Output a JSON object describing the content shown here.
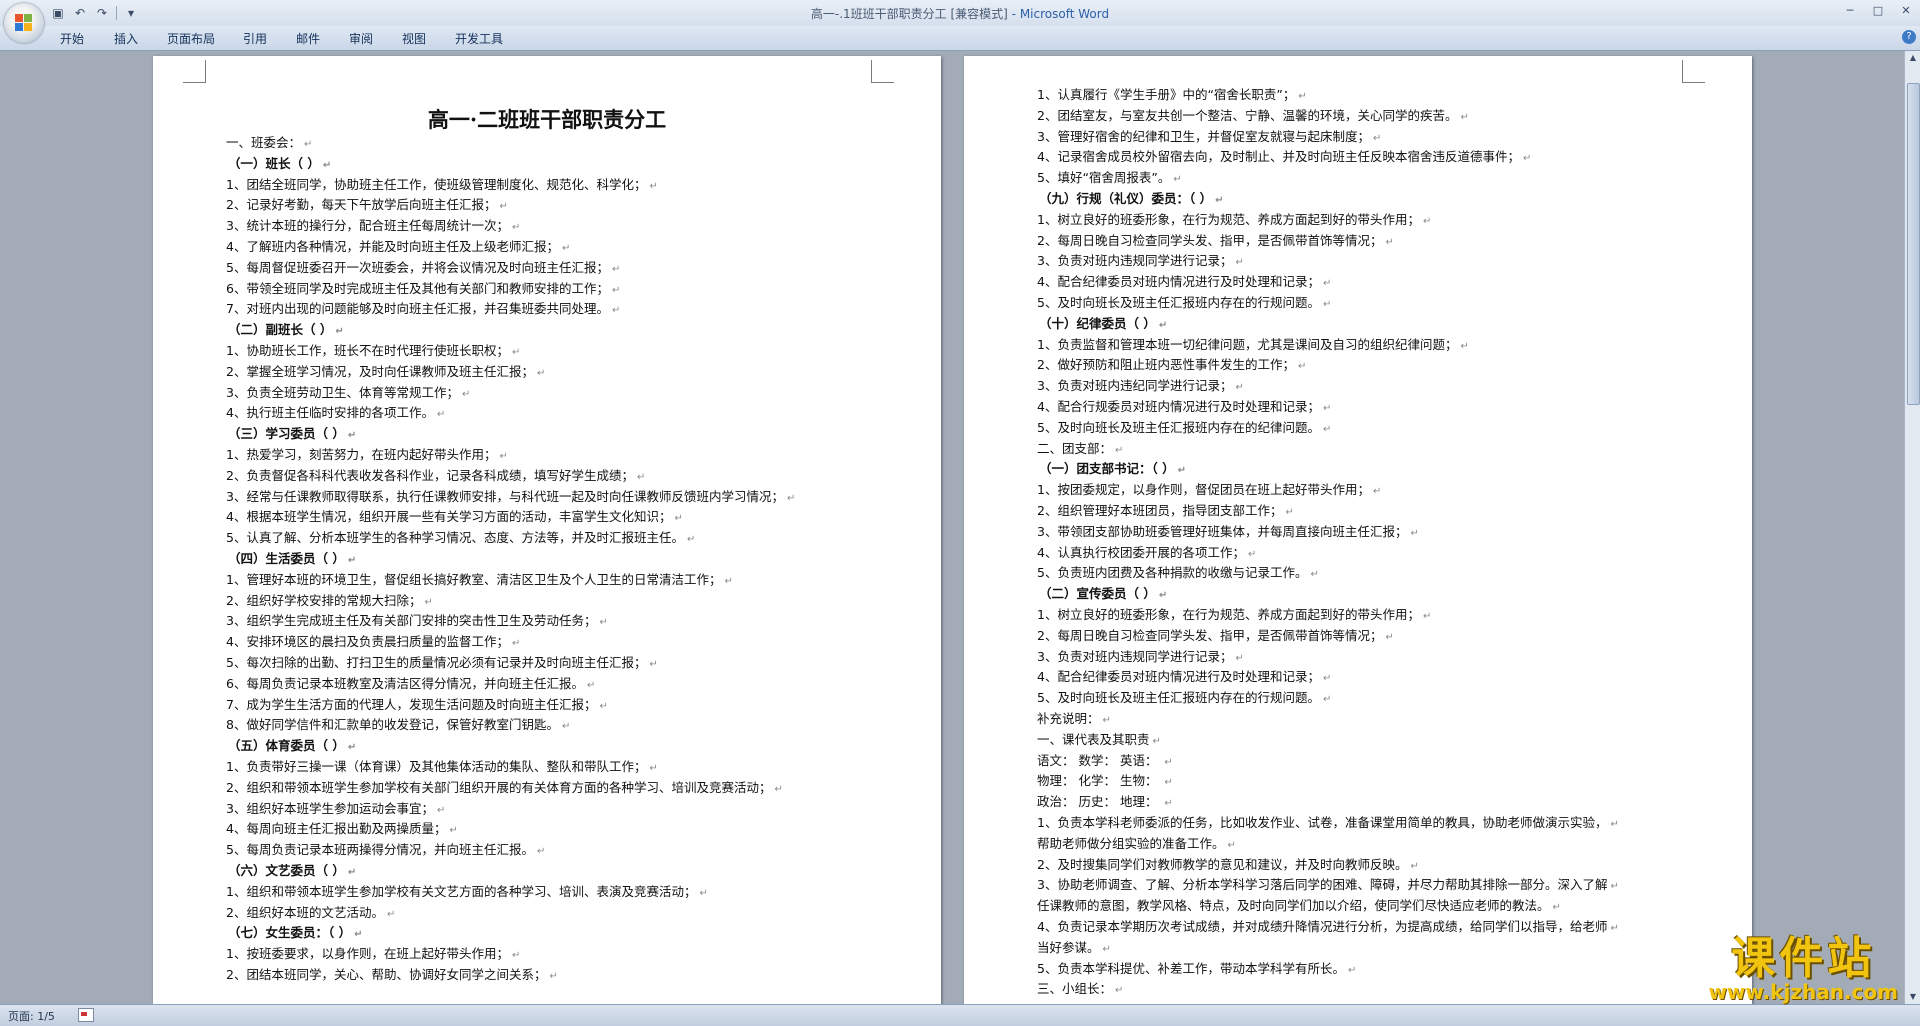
{
  "window": {
    "title": "高一-.1班班干部职责分工 [兼容模式]",
    "app_name": " - Microsoft Word",
    "status": "页面: 1/5"
  },
  "ribbon": {
    "tabs": [
      "开始",
      "插入",
      "页面布局",
      "引用",
      "邮件",
      "审阅",
      "视图",
      "开发工具"
    ]
  },
  "document": {
    "title": "高一·二班班干部职责分工",
    "left_lines": [
      {
        "t": "一、班委会：",
        "h": false
      },
      {
        "t": "（一）班长（          ）",
        "h": true
      },
      {
        "t": "1、团结全班同学，协助班主任工作，使班级管理制度化、规范化、科学化；",
        "h": false
      },
      {
        "t": "2、记录好考勤，每天下午放学后向班主任汇报；",
        "h": false
      },
      {
        "t": "3、统计本班的操行分，配合班主任每周统计一次；",
        "h": false
      },
      {
        "t": "4、了解班内各种情况，并能及时向班主任及上级老师汇报；",
        "h": false
      },
      {
        "t": "5、每周督促班委召开一次班委会，并将会议情况及时向班主任汇报；",
        "h": false
      },
      {
        "t": "6、带领全班同学及时完成班主任及其他有关部门和教师安排的工作；",
        "h": false
      },
      {
        "t": "7、对班内出现的问题能够及时向班主任汇报，并召集班委共同处理。",
        "h": false
      },
      {
        "t": "（二）副班长（          ）",
        "h": true
      },
      {
        "t": "1、协助班长工作，班长不在时代理行使班长职权；",
        "h": false
      },
      {
        "t": "2、掌握全班学习情况，及时向任课教师及班主任汇报；",
        "h": false
      },
      {
        "t": "3、负责全班劳动卫生、体育等常规工作；",
        "h": false
      },
      {
        "t": "4、执行班主任临时安排的各项工作。",
        "h": false
      },
      {
        "t": "（三）学习委员（          ）",
        "h": true
      },
      {
        "t": "1、热爱学习，刻苦努力，在班内起好带头作用；",
        "h": false
      },
      {
        "t": "2、负责督促各科科代表收发各科作业，记录各科成绩，填写好学生成绩；",
        "h": false
      },
      {
        "t": "3、经常与任课教师取得联系，执行任课教师安排，与科代班一起及时向任课教师反馈班内学习情况；",
        "h": false
      },
      {
        "t": "4、根据本班学生情况，组织开展一些有关学习方面的活动，丰富学生文化知识；",
        "h": false
      },
      {
        "t": "5、认真了解、分析本班学生的各种学习情况、态度、方法等，并及时汇报班主任。",
        "h": false
      },
      {
        "t": "（四）生活委员（          ）",
        "h": true
      },
      {
        "t": "1、管理好本班的环境卫生，督促组长搞好教室、清洁区卫生及个人卫生的日常清洁工作；",
        "h": false
      },
      {
        "t": "2、组织好学校安排的常规大扫除；",
        "h": false
      },
      {
        "t": "3、组织学生完成班主任及有关部门安排的突击性卫生及劳动任务；",
        "h": false
      },
      {
        "t": "4、安排环境区的晨扫及负责晨扫质量的监督工作；",
        "h": false
      },
      {
        "t": "5、每次扫除的出勤、打扫卫生的质量情况必须有记录并及时向班主任汇报；",
        "h": false
      },
      {
        "t": "6、每周负责记录本班教室及清洁区得分情况，并向班主任汇报。",
        "h": false
      },
      {
        "t": "7、成为学生生活方面的代理人，发现生活问题及时向班主任汇报；",
        "h": false
      },
      {
        "t": "8、做好同学信件和汇款单的收发登记，保管好教室门钥匙。",
        "h": false
      },
      {
        "t": "（五）体育委员（          ）",
        "h": true
      },
      {
        "t": "1、负责带好三操一课（体育课）及其他集体活动的集队、整队和带队工作；",
        "h": false
      },
      {
        "t": "2、组织和带领本班学生参加学校有关部门组织开展的有关体育方面的各种学习、培训及竞赛活动；",
        "h": false
      },
      {
        "t": "3、组织好本班学生参加运动会事宜；",
        "h": false
      },
      {
        "t": "4、每周向班主任汇报出勤及两操质量；",
        "h": false
      },
      {
        "t": "5、每周负责记录本班两操得分情况，并向班主任汇报。",
        "h": false
      },
      {
        "t": "（六）文艺委员（          ）",
        "h": true
      },
      {
        "t": "1、组织和带领本班学生参加学校有关文艺方面的各种学习、培训、表演及竞赛活动；",
        "h": false
      },
      {
        "t": "2、组织好本班的文艺活动。",
        "h": false
      },
      {
        "t": "（七）女生委员：（          ）",
        "h": true
      },
      {
        "t": "1、按班委要求，以身作则，在班上起好带头作用；",
        "h": false
      },
      {
        "t": "2、团结本班同学，关心、帮助、协调好女同学之间关系；",
        "h": false
      }
    ],
    "right_lines": [
      {
        "t": "1、认真履行《学生手册》中的“宿舍长职责”；",
        "h": false
      },
      {
        "t": "2、团结室友，与室友共创一个整洁、宁静、温馨的环境，关心同学的疾苦。",
        "h": false
      },
      {
        "t": "3、管理好宿舍的纪律和卫生，并督促室友就寝与起床制度；",
        "h": false
      },
      {
        "t": "4、记录宿舍成员校外留宿去向，及时制止、并及时向班主任反映本宿舍违反道德事件；",
        "h": false
      },
      {
        "t": "5、填好“宿舍周报表”。",
        "h": false
      },
      {
        "t": "（九）行规（礼仪）委员：（          ）",
        "h": true
      },
      {
        "t": "1、树立良好的班委形象，在行为规范、养成方面起到好的带头作用；",
        "h": false
      },
      {
        "t": "2、每周日晚自习检查同学头发、指甲，是否佩带首饰等情况；",
        "h": false
      },
      {
        "t": "3、负责对班内违规同学进行记录；",
        "h": false
      },
      {
        "t": "4、配合纪律委员对班内情况进行及时处理和记录；",
        "h": false
      },
      {
        "t": "5、及时向班长及班主任汇报班内存在的行规问题。",
        "h": false
      },
      {
        "t": "（十）纪律委员（          ）",
        "h": true
      },
      {
        "t": "1、负责监督和管理本班一切纪律问题，尤其是课间及自习的组织纪律问题；",
        "h": false
      },
      {
        "t": "2、做好预防和阻止班内恶性事件发生的工作；",
        "h": false
      },
      {
        "t": "3、负责对班内违纪同学进行记录；",
        "h": false
      },
      {
        "t": "4、配合行规委员对班内情况进行及时处理和记录；",
        "h": false
      },
      {
        "t": "5、及时向班长及班主任汇报班内存在的纪律问题。",
        "h": false
      },
      {
        "t": "二、团支部：",
        "h": false
      },
      {
        "t": "（一）团支部书记：（        ）",
        "h": true
      },
      {
        "t": "1、按团委规定，以身作则，督促团员在班上起好带头作用；",
        "h": false
      },
      {
        "t": "2、组织管理好本班团员，指导团支部工作；",
        "h": false
      },
      {
        "t": "3、带领团支部协助班委管理好班集体，并每周直接向班主任汇报；",
        "h": false
      },
      {
        "t": "4、认真执行校团委开展的各项工作；",
        "h": false
      },
      {
        "t": "5、负责班内团费及各种捐款的收缴与记录工作。",
        "h": false
      },
      {
        "t": "（二）宣传委员（          ）",
        "h": true
      },
      {
        "t": "1、树立良好的班委形象，在行为规范、养成方面起到好的带头作用；",
        "h": false
      },
      {
        "t": "2、每周日晚自习检查同学头发、指甲，是否佩带首饰等情况；",
        "h": false
      },
      {
        "t": "3、负责对班内违规同学进行记录；",
        "h": false
      },
      {
        "t": "4、配合纪律委员对班内情况进行及时处理和记录；",
        "h": false
      },
      {
        "t": "5、及时向班长及班主任汇报班内存在的行规问题。",
        "h": false
      },
      {
        "t": "补充说明：",
        "h": false
      },
      {
        "t": "一、课代表及其职责",
        "h": false
      },
      {
        "t": "  语文：              数学：            英语：             ",
        "h": false
      },
      {
        "t": "  物理：              化学：              生物：             ",
        "h": false
      },
      {
        "t": "  政治：              历史：            地理：             ",
        "h": false
      },
      {
        "t": "1、负责本学科老师委派的任务，比如收发作业、试卷，准备课堂用简单的教具，协助老师做演示实验，",
        "h": false
      },
      {
        "t": "    帮助老师做分组实验的准备工作。",
        "h": false
      },
      {
        "t": "2、及时搜集同学们对教师教学的意见和建议，并及时向教师反映。",
        "h": false
      },
      {
        "t": "3、协助老师调查、了解、分析本学科学习落后同学的困难、障碍，并尽力帮助其排除一部分。深入了解",
        "h": false
      },
      {
        "t": "任课教师的意图，教学风格、特点，及时向同学们加以介绍，使同学们尽快适应老师的教法。",
        "h": false
      },
      {
        "t": "4、负责记录本学期历次考试成绩，并对成绩升降情况进行分析，为提高成绩，给同学们以指导，给老师",
        "h": false
      },
      {
        "t": "当好参谋。",
        "h": false
      },
      {
        "t": "5、负责本学科提优、补差工作，带动本学科学有所长。",
        "h": false
      },
      {
        "t": "三、小组长：",
        "h": false
      }
    ]
  },
  "watermark": {
    "brand": "课件站",
    "url": "www.kjzhan.com"
  },
  "colors": {
    "ribbon": "#d5dfec",
    "workspace": "#a3acb6",
    "page": "#ffffff",
    "watermark": "#f1c40f"
  }
}
